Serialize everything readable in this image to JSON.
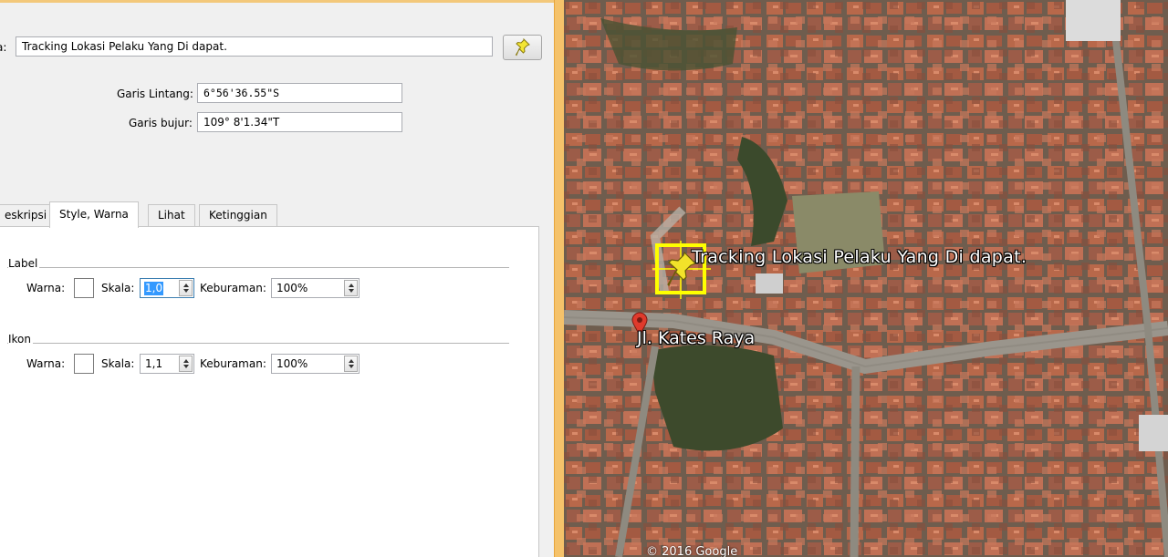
{
  "dialog": {
    "name_label": "a:",
    "name_value": "Tracking Lokasi Pelaku Yang Di dapat.",
    "latitude_label": "Garis Lintang:",
    "latitude_value": "6°56'36.55\"S",
    "longitude_label": "Garis bujur:",
    "longitude_value": "109° 8'1.34\"T",
    "tabs": [
      {
        "label": "eskripsi",
        "active": false
      },
      {
        "label": "Style, Warna",
        "active": true
      },
      {
        "label": "Lihat",
        "active": false
      },
      {
        "label": "Ketinggian",
        "active": false
      }
    ],
    "style": {
      "label_group": {
        "title": "Label",
        "color_label": "Warna:",
        "scale_label": "Skala:",
        "scale_value": "1,0",
        "opacity_label": "Keburaman:",
        "opacity_value": "100%"
      },
      "icon_group": {
        "title": "Ikon",
        "color_label": "Warna:",
        "scale_label": "Skala:",
        "scale_value": "1,1",
        "opacity_label": "Keburaman:",
        "opacity_value": "100%"
      }
    }
  },
  "map": {
    "placemark_label": "Tracking Lokasi Pelaku Yang Di dapat.",
    "road_label": "Jl. Kates Raya",
    "copyright": "© 2016 Google",
    "colors": {
      "selection_box": "#ffff00",
      "pin": "#f2e22a",
      "road_marker": "#e03a2c"
    }
  }
}
